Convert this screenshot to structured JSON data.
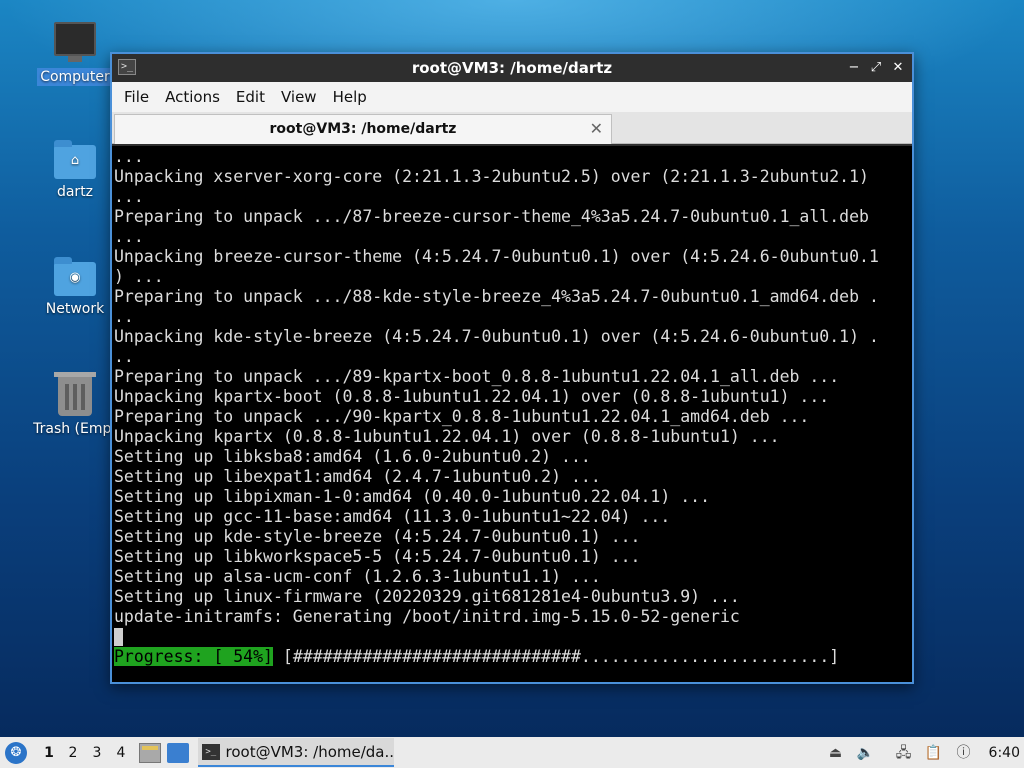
{
  "desktop": {
    "icons": [
      {
        "label": "Computer"
      },
      {
        "label": "dartz"
      },
      {
        "label": "Network"
      },
      {
        "label": "Trash (Empt"
      }
    ]
  },
  "window": {
    "title": "root@VM3: /home/dartz",
    "icon_glyph": ">_",
    "controls": {
      "minimize": "−",
      "maximize": "⤢",
      "close": "✕"
    },
    "menu": [
      "File",
      "Actions",
      "Edit",
      "View",
      "Help"
    ],
    "tab": {
      "label": "root@VM3: /home/dartz",
      "close": "✕"
    }
  },
  "terminal": {
    "lines": [
      "...",
      "Unpacking xserver-xorg-core (2:21.1.3-2ubuntu2.5) over (2:21.1.3-2ubuntu2.1)",
      "...",
      "Preparing to unpack .../87-breeze-cursor-theme_4%3a5.24.7-0ubuntu0.1_all.deb",
      "...",
      "Unpacking breeze-cursor-theme (4:5.24.7-0ubuntu0.1) over (4:5.24.6-0ubuntu0.1",
      ") ...",
      "Preparing to unpack .../88-kde-style-breeze_4%3a5.24.7-0ubuntu0.1_amd64.deb .",
      "..",
      "Unpacking kde-style-breeze (4:5.24.7-0ubuntu0.1) over (4:5.24.6-0ubuntu0.1) .",
      "..",
      "Preparing to unpack .../89-kpartx-boot_0.8.8-1ubuntu1.22.04.1_all.deb ...",
      "Unpacking kpartx-boot (0.8.8-1ubuntu1.22.04.1) over (0.8.8-1ubuntu1) ...",
      "Preparing to unpack .../90-kpartx_0.8.8-1ubuntu1.22.04.1_amd64.deb ...",
      "Unpacking kpartx (0.8.8-1ubuntu1.22.04.1) over (0.8.8-1ubuntu1) ...",
      "Setting up libksba8:amd64 (1.6.0-2ubuntu0.2) ...",
      "Setting up libexpat1:amd64 (2.4.7-1ubuntu0.2) ...",
      "Setting up libpixman-1-0:amd64 (0.40.0-1ubuntu0.22.04.1) ...",
      "Setting up gcc-11-base:amd64 (11.3.0-1ubuntu1~22.04) ...",
      "Setting up kde-style-breeze (4:5.24.7-0ubuntu0.1) ...",
      "Setting up libkworkspace5-5 (4:5.24.7-0ubuntu0.1) ...",
      "Setting up alsa-ucm-conf (1.2.6.3-1ubuntu1.1) ...",
      "Setting up linux-firmware (20220329.git681281e4-0ubuntu3.9) ...",
      "update-initramfs: Generating /boot/initrd.img-5.15.0-52-generic"
    ],
    "progress": {
      "label": "Progress: [ 54%]",
      "bar": " [#############################.........................]",
      "percent": 54
    }
  },
  "taskbar": {
    "start_glyph": "❂",
    "workspaces": [
      "1",
      "2",
      "3",
      "4"
    ],
    "active_workspace": "1",
    "task": {
      "label": "root@VM3: /home/da...",
      "icon_glyph": ">_"
    },
    "tray": {
      "clock": "6:40"
    }
  }
}
